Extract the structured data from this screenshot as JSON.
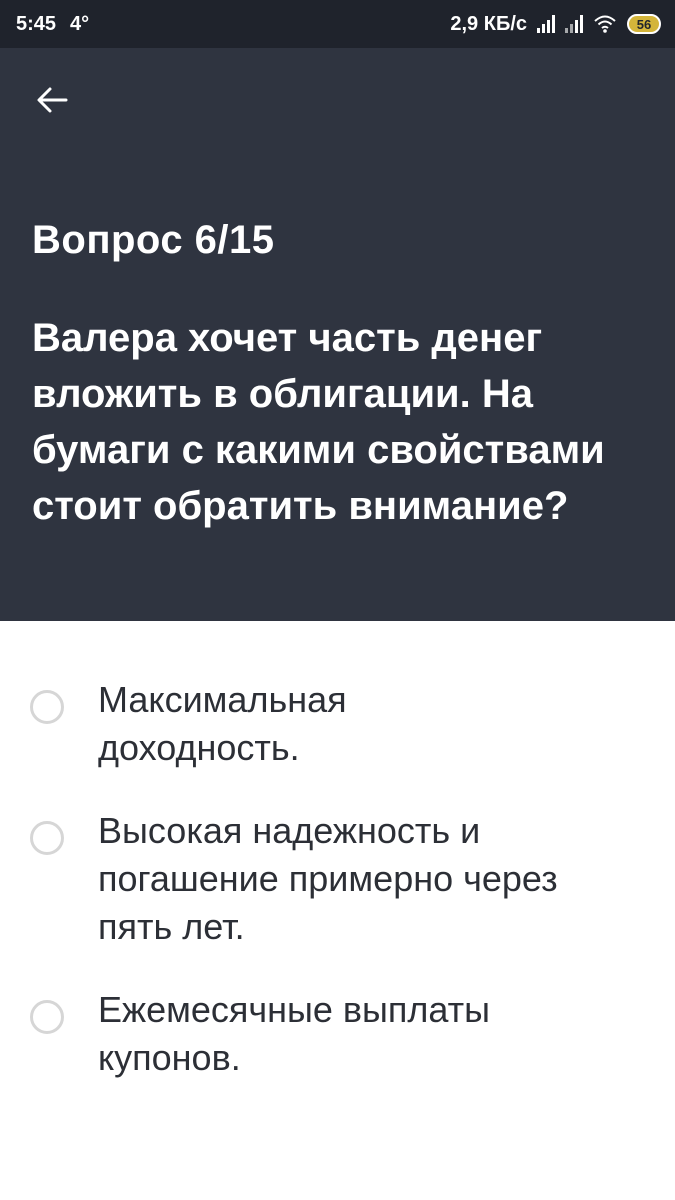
{
  "status_bar": {
    "time": "5:45",
    "temperature": "4°",
    "network_speed": "2,9 КБ/с",
    "battery": "56",
    "icons": [
      "signal-icon",
      "signal-icon",
      "wifi-icon",
      "battery-icon"
    ]
  },
  "header": {
    "back_icon": "arrow-left-icon",
    "counter": "Вопрос 6/15",
    "question": "Валера хочет часть денег вложить в облигации. На бумаги с какими свойствами стоит обратить внимание?"
  },
  "options": [
    {
      "label": "Максимальная доходность.",
      "selected": false
    },
    {
      "label": "Высокая надежность и погашение примерно через пять лет.",
      "selected": false
    },
    {
      "label": "Ежемесячные выплаты купонов.",
      "selected": false
    }
  ],
  "colors": {
    "status_bar": "#1f232c",
    "header_background": "#2f3440",
    "header_text": "#ffffff",
    "option_text": "#2c2f36",
    "radio_border": "#d6d6d6"
  }
}
